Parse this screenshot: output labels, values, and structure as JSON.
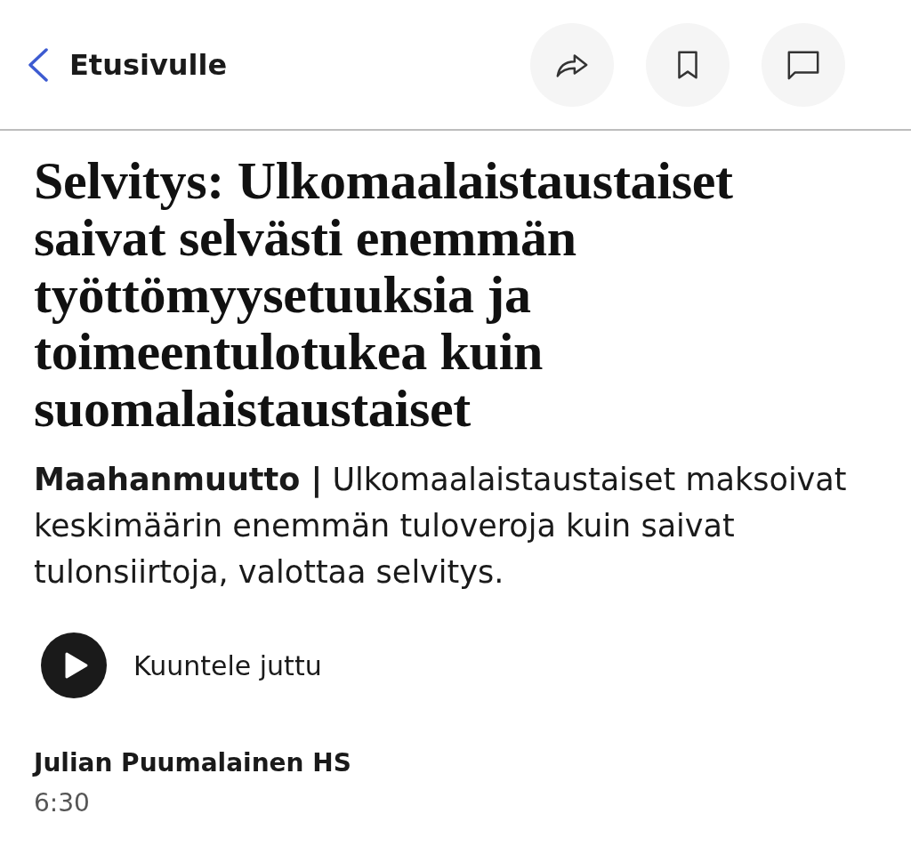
{
  "header": {
    "back": {
      "label": "Etusivulle"
    },
    "actions": [
      {
        "kind": "share"
      },
      {
        "kind": "bookmark"
      },
      {
        "kind": "comment"
      }
    ]
  },
  "article": {
    "headline": "Selvitys: Ulkomaalaistaustaiset saivat selvästi enemmän työttömyysetuuksia ja toimeentulotukea kuin suomalaistaustaiset",
    "lede": "**Maahanmuutto |** Ulkomaalaistaustaiset maksoivat keskimäärin enemmän tuloveroja kuin saivat tulonsiirtoja, valottaa selvitys.",
    "listen": {
      "label": "Kuuntele juttu"
    },
    "author": "Julian Puumalainen HS",
    "time": "6:30"
  }
}
